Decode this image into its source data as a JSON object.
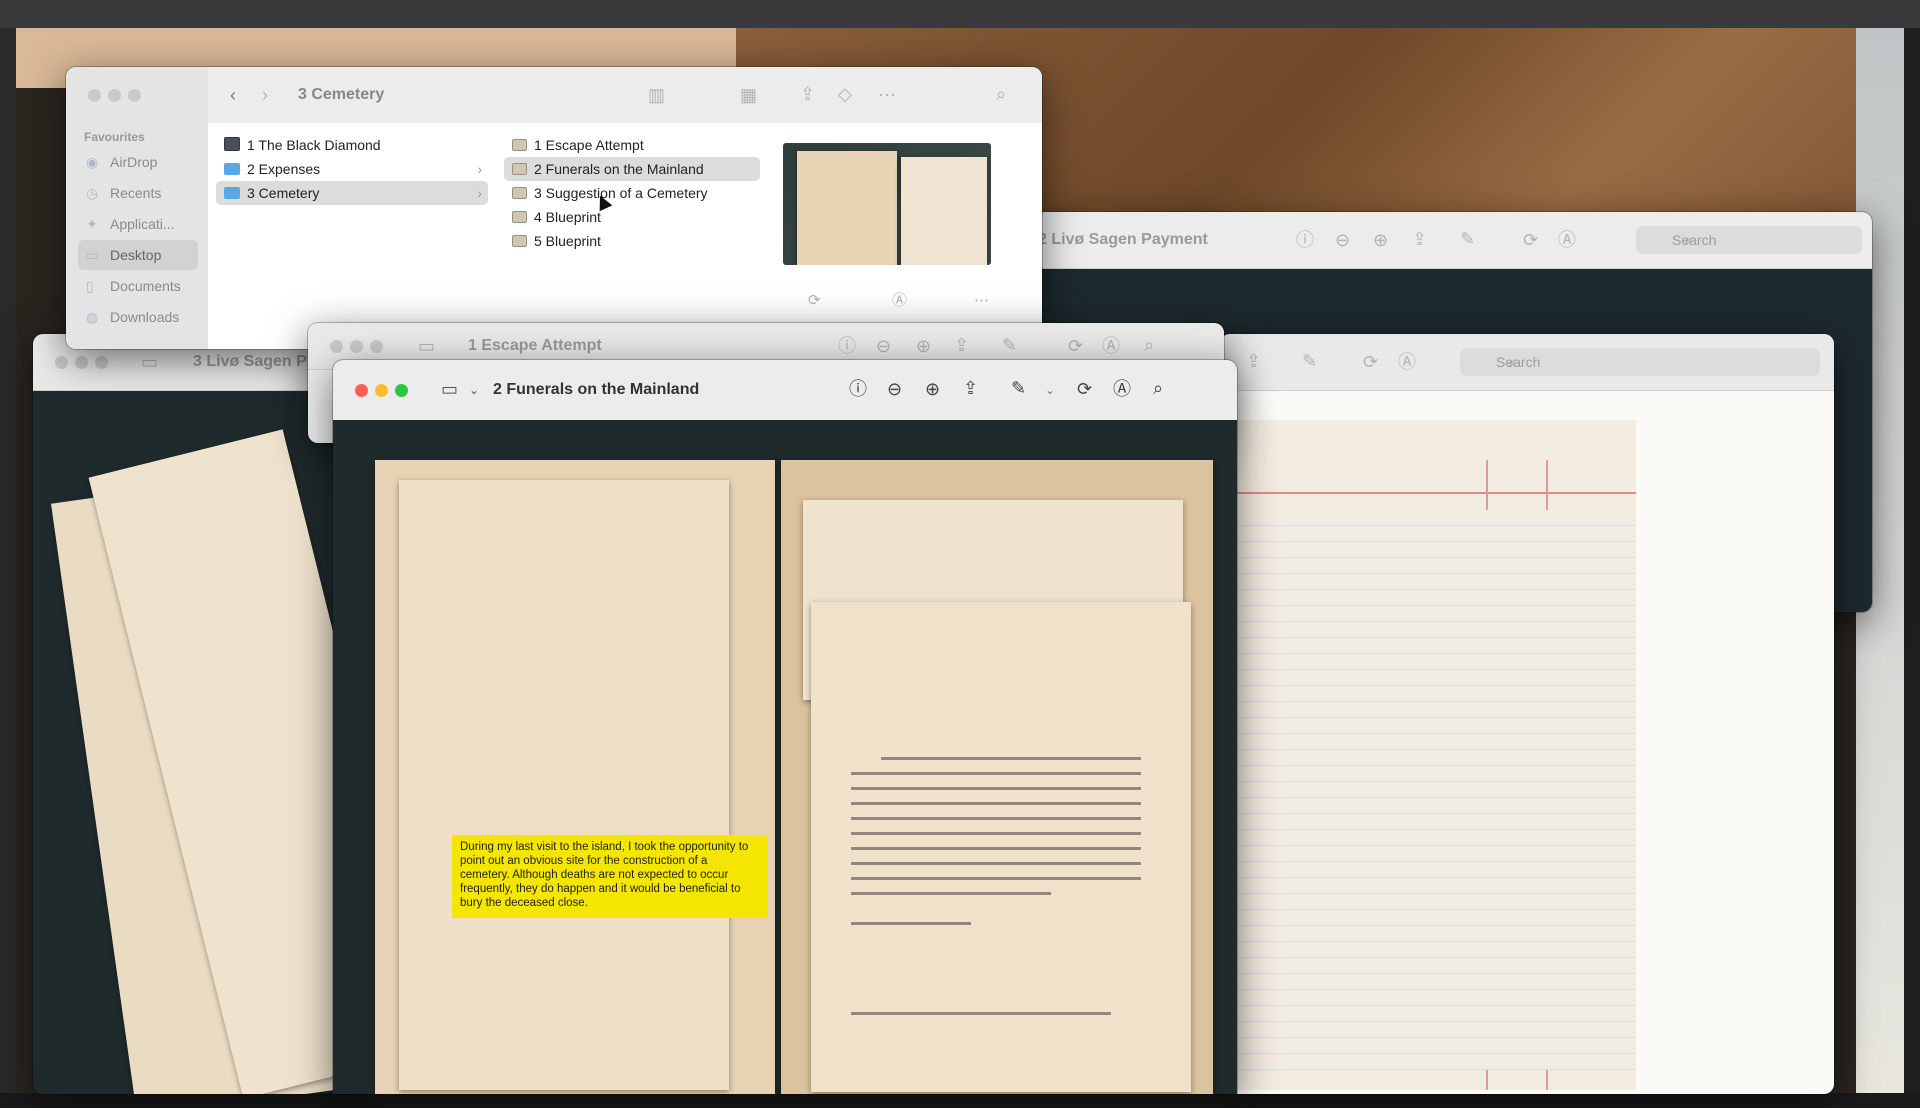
{
  "finder": {
    "title": "3 Cemetery",
    "sidebar_heading": "Favourites",
    "sidebar": [
      {
        "label": "AirDrop",
        "icon": "airdrop-icon"
      },
      {
        "label": "Recents",
        "icon": "clock-icon"
      },
      {
        "label": "Applicati...",
        "icon": "applications-icon"
      },
      {
        "label": "Desktop",
        "icon": "desktop-icon",
        "selected": true
      },
      {
        "label": "Documents",
        "icon": "document-icon"
      },
      {
        "label": "Downloads",
        "icon": "download-icon"
      }
    ],
    "column1": [
      {
        "label": "1 The Black Diamond",
        "icon": "image-icon"
      },
      {
        "label": "2 Expenses",
        "icon": "folder-icon"
      },
      {
        "label": "3 Cemetery",
        "icon": "folder-icon",
        "selected": true
      }
    ],
    "column2": [
      {
        "label": "1 Escape Attempt"
      },
      {
        "label": "2 Funerals on the Mainland",
        "selected": true
      },
      {
        "label": "3 Suggestion of a Cemetery"
      },
      {
        "label": "4 Blueprint"
      },
      {
        "label": "5 Blueprint"
      }
    ]
  },
  "windows": {
    "livo_back": {
      "title": "2 Livø Sagen Payment",
      "search_placeholder": "Search"
    },
    "ledger": {
      "search_placeholder": "Search"
    },
    "livo_left": {
      "title": "3 Livø Sagen P"
    },
    "escape": {
      "title": "1 Escape Attempt"
    },
    "funerals": {
      "title": "2 Funerals on the Mainland"
    }
  },
  "note": {
    "text": "During my last visit to the island, I took the opportunity to point out an obvious site for the construction of a cemetery. Although deaths are not expected to occur frequently, they do happen and it would be beneficial to bury the deceased close."
  },
  "colors": {
    "traffic_red": "#ff5f57",
    "traffic_yellow": "#febc2e",
    "traffic_green": "#28c840",
    "note_yellow": "#f4e600"
  }
}
